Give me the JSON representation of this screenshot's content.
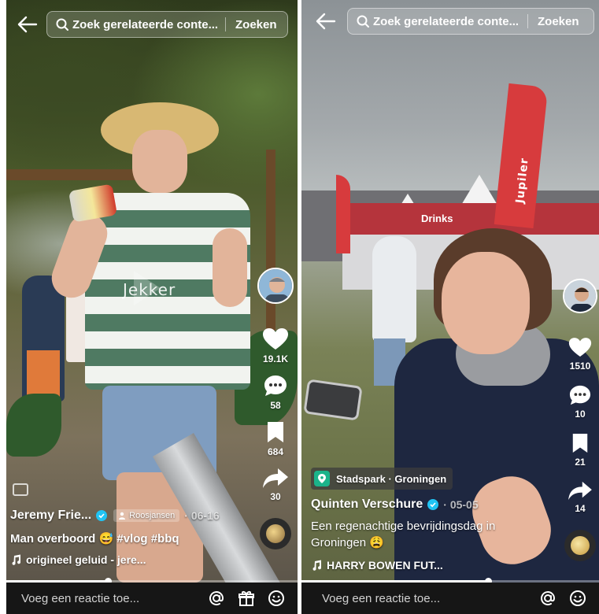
{
  "left": {
    "search": {
      "query": "Zoek gerelateerde conte...",
      "button": "Zoeken"
    },
    "watermark": "Jekker",
    "actions": {
      "like_count": "19.1K",
      "comment_count": "58",
      "save_count": "684",
      "share_count": "30"
    },
    "post": {
      "author": "Jeremy Frie...",
      "tag_chip": "Roosjansen",
      "date": "· 06-16",
      "description": "Man overboord 😅 #vlog #bbq",
      "music": "origineel geluid - jere..."
    },
    "progress": 0.35,
    "bottom": {
      "comment_placeholder": "Voeg een reactie toe..."
    }
  },
  "right": {
    "search": {
      "query": "Zoek gerelateerde conte...",
      "button": "Zoeken"
    },
    "scene_text": {
      "flag": "Jupiler",
      "banner": "Drinks"
    },
    "actions": {
      "like_count": "1510",
      "comment_count": "10",
      "save_count": "21",
      "share_count": "14"
    },
    "post": {
      "location": "Stadspark · Groningen",
      "author": "Quinten Verschure",
      "date": "· 05-05",
      "description_line1": "Een regenachtige bevrijdingsdag in",
      "description_line2": "Groningen 😩",
      "music": "HARRY BOWEN FUT..."
    },
    "progress": 0.63,
    "bottom": {
      "comment_placeholder": "Voeg een reactie toe..."
    }
  },
  "colors": {
    "verified": "#20c4f4",
    "location_pin": "#1bb38a",
    "bottom_bar": "#161616"
  }
}
